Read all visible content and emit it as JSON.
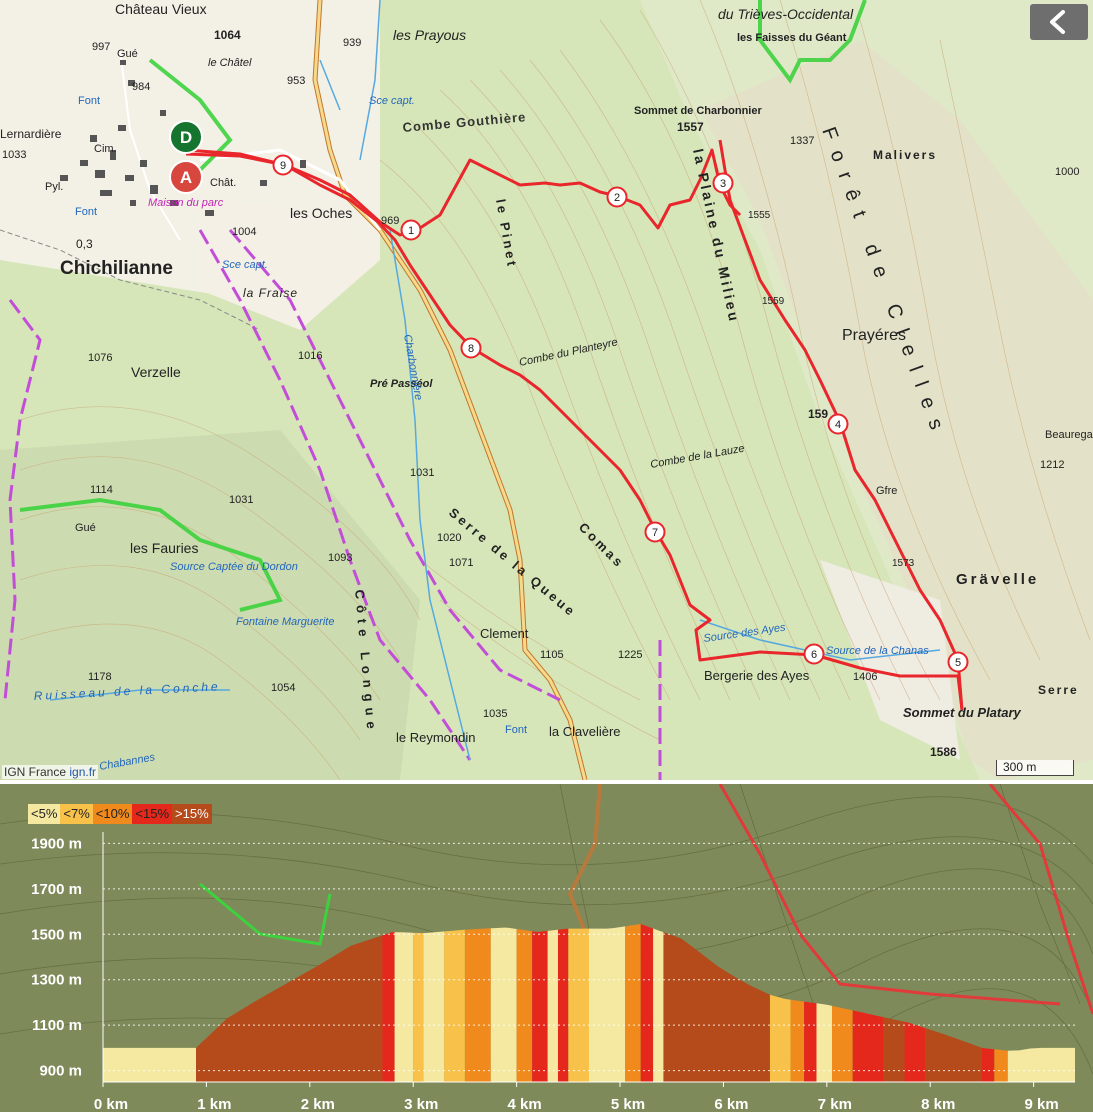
{
  "map": {
    "labels": {
      "chateau_vieux": "Château Vieux",
      "trieves": "du Trièves-Occidental",
      "faisses": "les Faisses du Géant",
      "prayous": "les Prayous",
      "e939": "939",
      "e953": "953",
      "e997": "997",
      "e984": "984",
      "e1064": "1064",
      "le_chatel": "le Châtel",
      "gue1": "Gué",
      "combe_gouthiere": "Combe Gouthière",
      "sommet_charbonnier": "Sommet de Charbonnier",
      "e1557": "1557",
      "e1337": "1337",
      "malivers": "Malivers",
      "e1000": "1000",
      "foret_clelles": "Forêt de Clelles",
      "lernardiere": "Lernardière",
      "e1033": "1033",
      "pyl": "Pyl.",
      "font1": "Font",
      "font2": "Font",
      "cim": "Cim.",
      "chat": "Chât.",
      "maison_parc": "Maison du parc",
      "les_oches": "les Oches",
      "e969": "969",
      "e1004": "1004",
      "e03": "0,3",
      "chichilianne": "Chichilianne",
      "sce_capt1": "Sce capt.",
      "sce_capt2": "Sce capt.",
      "la_fraise": "la Fraise",
      "le_pinet": "le Pinet",
      "plaine_milieu": "la Plaine du Milieu",
      "e1555": "1555",
      "e1559": "1559",
      "prayeres": "Prayéres",
      "combe_planteyre": "Combe du Planteyre",
      "e1076": "1076",
      "e1016": "1016",
      "verzelle": "Verzelle",
      "pre_passeol": "Pré Passéol",
      "charbonniere": "Charbonnière",
      "e159": "159",
      "beauregard": "Beauregar",
      "e1212": "1212",
      "combe_lauze": "Combe de la Lauze",
      "gfre": "Gfre",
      "e1031a": "1031",
      "e1114": "1114",
      "e1031b": "1031",
      "gue2": "Gué",
      "les_fauries": "les Fauries",
      "source_dordon": "Source Captée du Dordon",
      "serre_queue": "Serre de la Queue",
      "comas": "Comas",
      "e1020": "1020",
      "e1071": "1071",
      "e1093": "1093",
      "e1573": "1573",
      "gravelle": "Grävelle",
      "fontaine_marguerite": "Fontaine Marguerite",
      "clement": "Clement",
      "source_ayes": "Source des Ayes",
      "source_chanas": "Source de la Chanas",
      "e1105": "1105",
      "e1225": "1225",
      "bergerie": "Bergerie des Ayes",
      "e1406": "1406",
      "serre": "Serre",
      "sommet_platary": "Sommet du Platary",
      "e1178": "1178",
      "e1054": "1054",
      "ruisseau_conche": "Ruisseau de la Conche",
      "cote_long": "Côte Longue",
      "e1035": "1035",
      "le_reymondin": "le Reymondin",
      "la_claveliere": "la Clavelière",
      "font3": "Font",
      "e1586": "1586",
      "chabannes": "Chabannes"
    },
    "markers": {
      "start": "D",
      "end": "A"
    },
    "waypoints": [
      "1",
      "2",
      "3",
      "4",
      "5",
      "6",
      "7",
      "8",
      "9"
    ],
    "attribution": {
      "text": "IGN France ",
      "link": "ign.fr"
    },
    "scale": "300 m"
  },
  "colors": {
    "route": "#e8262c",
    "lt5": "#f5e8a0",
    "lt7": "#f8c24a",
    "lt10": "#f08a1c",
    "lt15": "#e4281c",
    "gt15": "#b54a1a"
  },
  "legend": [
    "<5%",
    "<7%",
    "<10%",
    "<15%",
    ">15%"
  ],
  "chart_data": {
    "type": "area",
    "title": "",
    "xlabel": "",
    "ylabel": "",
    "x_unit": "km",
    "y_unit": "m",
    "xlim": [
      0,
      9.4
    ],
    "ylim": [
      850,
      1950
    ],
    "x_ticks": [
      "0 km",
      "1 km",
      "2 km",
      "3 km",
      "4 km",
      "5 km",
      "6 km",
      "7 km",
      "8 km",
      "9 km"
    ],
    "y_ticks": [
      "900 m",
      "1100 m",
      "1300 m",
      "1500 m",
      "1700 m",
      "1900 m"
    ],
    "grid": true,
    "legend_position": "top-left",
    "series": [
      {
        "x": [
          0,
          0.9,
          1.2,
          1.6,
          2.0,
          2.4,
          2.8,
          3.1,
          3.5,
          3.9,
          4.2,
          4.5,
          4.9,
          5.2,
          5.6,
          6.0,
          6.4,
          6.6,
          7.0,
          7.4,
          7.8,
          8.2,
          8.5,
          8.8,
          9.0,
          9.4
        ],
        "y": [
          1000,
          1000,
          1130,
          1240,
          1340,
          1450,
          1510,
          1505,
          1520,
          1530,
          1510,
          1525,
          1525,
          1545,
          1480,
          1340,
          1240,
          1215,
          1190,
          1150,
          1110,
          1050,
          1000,
          985,
          1000,
          1000
        ]
      }
    ],
    "slope_bands": [
      {
        "from": 0,
        "to": 0.9,
        "class": "lt5"
      },
      {
        "from": 0.9,
        "to": 2.7,
        "class": "gt15"
      },
      {
        "from": 2.7,
        "to": 2.82,
        "class": "lt15"
      },
      {
        "from": 2.82,
        "to": 3.0,
        "class": "lt5"
      },
      {
        "from": 3.0,
        "to": 3.1,
        "class": "lt7"
      },
      {
        "from": 3.1,
        "to": 3.3,
        "class": "lt5"
      },
      {
        "from": 3.3,
        "to": 3.5,
        "class": "lt7"
      },
      {
        "from": 3.5,
        "to": 3.75,
        "class": "lt10"
      },
      {
        "from": 3.75,
        "to": 4.0,
        "class": "lt5"
      },
      {
        "from": 4.0,
        "to": 4.15,
        "class": "lt10"
      },
      {
        "from": 4.15,
        "to": 4.3,
        "class": "lt15"
      },
      {
        "from": 4.3,
        "to": 4.4,
        "class": "lt5"
      },
      {
        "from": 4.4,
        "to": 4.5,
        "class": "lt15"
      },
      {
        "from": 4.5,
        "to": 4.7,
        "class": "lt7"
      },
      {
        "from": 4.7,
        "to": 5.05,
        "class": "lt5"
      },
      {
        "from": 5.05,
        "to": 5.2,
        "class": "lt10"
      },
      {
        "from": 5.2,
        "to": 5.32,
        "class": "lt15"
      },
      {
        "from": 5.32,
        "to": 5.42,
        "class": "lt5"
      },
      {
        "from": 5.42,
        "to": 6.45,
        "class": "gt15"
      },
      {
        "from": 6.45,
        "to": 6.65,
        "class": "lt7"
      },
      {
        "from": 6.65,
        "to": 6.78,
        "class": "lt10"
      },
      {
        "from": 6.78,
        "to": 6.9,
        "class": "lt15"
      },
      {
        "from": 6.9,
        "to": 7.05,
        "class": "lt5"
      },
      {
        "from": 7.05,
        "to": 7.25,
        "class": "lt10"
      },
      {
        "from": 7.25,
        "to": 7.55,
        "class": "lt15"
      },
      {
        "from": 7.55,
        "to": 7.75,
        "class": "gt15"
      },
      {
        "from": 7.75,
        "to": 7.95,
        "class": "lt15"
      },
      {
        "from": 7.95,
        "to": 8.5,
        "class": "gt15"
      },
      {
        "from": 8.5,
        "to": 8.62,
        "class": "lt15"
      },
      {
        "from": 8.62,
        "to": 8.75,
        "class": "lt10"
      },
      {
        "from": 8.75,
        "to": 9.4,
        "class": "lt5"
      }
    ]
  }
}
